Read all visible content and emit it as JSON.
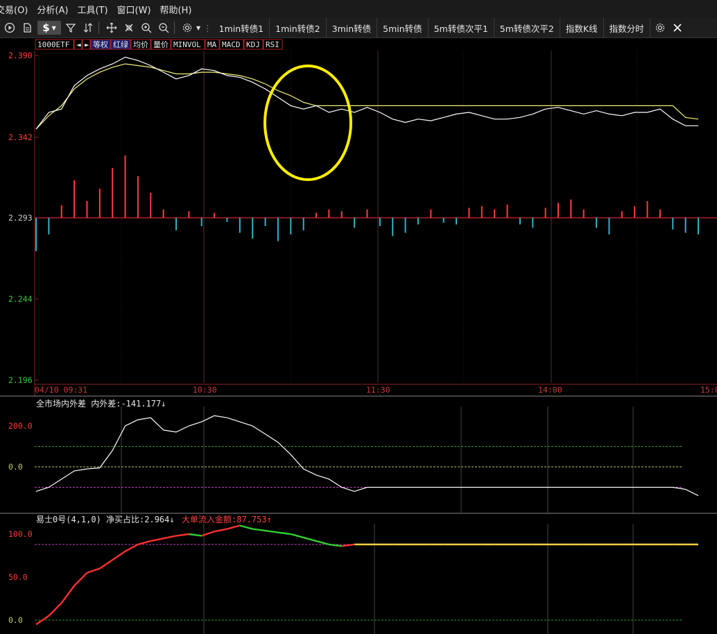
{
  "menu": {
    "items": [
      "交易(O)",
      "分析(A)",
      "工具(T)",
      "窗口(W)",
      "帮助(H)"
    ]
  },
  "toolbar": {
    "dollar_label": "$",
    "tabs": [
      "1min转债1",
      "1min转债2",
      "3min转债",
      "5min转债",
      "5m转债次平1",
      "5m转债次平2",
      "指数K线",
      "指数分时"
    ]
  },
  "indicator_tabs": [
    "1000ETF",
    "◄",
    "►",
    "等权",
    "红绿",
    "均价",
    "量价",
    "MINVOL",
    "MA",
    "MACD",
    "KDJ",
    "RSI"
  ],
  "main_chart": {
    "y_ticks": [
      "2.390",
      "2.342",
      "2.293",
      "2.244",
      "2.196"
    ],
    "x_ticks": [
      "04/10 09:31",
      "10:30",
      "11:30",
      "14:00",
      "15:0"
    ]
  },
  "panel2": {
    "title": "全市场内外差",
    "metric_label": "内外差:",
    "metric_value": "-141.177",
    "arrow": "↓",
    "y_ticks": [
      "200.0",
      "0.0"
    ]
  },
  "panel3": {
    "title": "易士0号(4,1,0)",
    "m1_label": "净买占比:",
    "m1_value": "2.964",
    "m1_arrow": "↓",
    "m2_label": "大单流入金额:",
    "m2_value": "87.753",
    "m2_arrow": "↑",
    "y_ticks": [
      "100.0",
      "50.0",
      "0.0"
    ]
  },
  "colors": {
    "background": "#000000",
    "up_red": "#ff3b3b",
    "down_cyan": "#2fb3c9",
    "price_white": "#ffffff",
    "avg_yellow": "#f5f07a",
    "annotation_circle": "#ffee00",
    "grid_dark_red": "#4a1a1a"
  },
  "chart_data": {
    "type": "line",
    "price": [
      2.346,
      2.356,
      2.358,
      2.372,
      2.378,
      2.382,
      2.385,
      2.389,
      2.387,
      2.384,
      2.38,
      2.376,
      2.378,
      2.382,
      2.381,
      2.378,
      2.377,
      2.374,
      2.37,
      2.365,
      2.36,
      2.358,
      2.36,
      2.356,
      2.358,
      2.356,
      2.359,
      2.356,
      2.352,
      2.35,
      2.352,
      2.351,
      2.353,
      2.355,
      2.356,
      2.354,
      2.352,
      2.352,
      2.353,
      2.355,
      2.358,
      2.359,
      2.357,
      2.355,
      2.357,
      2.355,
      2.354,
      2.356,
      2.356,
      2.358,
      2.352,
      2.348,
      2.348
    ],
    "avg_price": [
      2.346,
      2.354,
      2.36,
      2.37,
      2.376,
      2.38,
      2.383,
      2.385,
      2.384,
      2.383,
      2.381,
      2.379,
      2.379,
      2.38,
      2.38,
      2.379,
      2.378,
      2.376,
      2.373,
      2.369,
      2.366,
      2.362,
      2.36,
      2.36,
      2.36,
      2.36,
      2.36,
      2.36,
      2.36,
      2.36,
      2.36,
      2.36,
      2.36,
      2.36,
      2.36,
      2.36,
      2.36,
      2.36,
      2.36,
      2.36,
      2.36,
      2.36,
      2.36,
      2.36,
      2.36,
      2.36,
      2.36,
      2.36,
      2.36,
      2.36,
      2.36,
      2.353,
      2.352
    ],
    "volume_net": [
      -40,
      -20,
      15,
      45,
      20,
      35,
      60,
      75,
      50,
      30,
      10,
      -15,
      8,
      -10,
      6,
      -5,
      -18,
      -25,
      -10,
      -28,
      -20,
      -15,
      6,
      10,
      8,
      -12,
      10,
      -10,
      -22,
      -18,
      -8,
      10,
      -6,
      -8,
      12,
      14,
      10,
      16,
      -8,
      -12,
      12,
      18,
      22,
      10,
      -12,
      -20,
      8,
      14,
      20,
      10,
      -14,
      -18,
      -20
    ],
    "panel2_values": [
      -120,
      -100,
      -60,
      -20,
      -10,
      -5,
      80,
      200,
      230,
      240,
      180,
      170,
      200,
      220,
      250,
      240,
      220,
      200,
      160,
      120,
      60,
      -10,
      -40,
      -60,
      -100,
      -120,
      -100,
      -100,
      -100,
      -100,
      -100,
      -100,
      -100,
      -100,
      -100,
      -100,
      -100,
      -100,
      -100,
      -100,
      -100,
      -100,
      -100,
      -100,
      -100,
      -100,
      -100,
      -100,
      -100,
      -100,
      -100,
      -110,
      -141
    ],
    "panel2_ref_lines": [
      100,
      0,
      -100
    ],
    "panel3_values": [
      -5,
      5,
      20,
      40,
      55,
      60,
      70,
      80,
      88,
      92,
      95,
      98,
      100,
      98,
      103,
      106,
      110,
      106,
      104,
      102,
      100,
      96,
      92,
      88,
      86,
      88,
      88,
      88,
      88,
      88,
      88,
      88,
      88,
      88,
      88,
      88,
      88,
      88,
      88,
      88,
      88,
      88,
      88,
      88,
      88,
      88,
      88,
      88,
      88,
      88,
      88,
      88,
      88
    ],
    "panel3_ref_lines": [
      88,
      0
    ]
  }
}
